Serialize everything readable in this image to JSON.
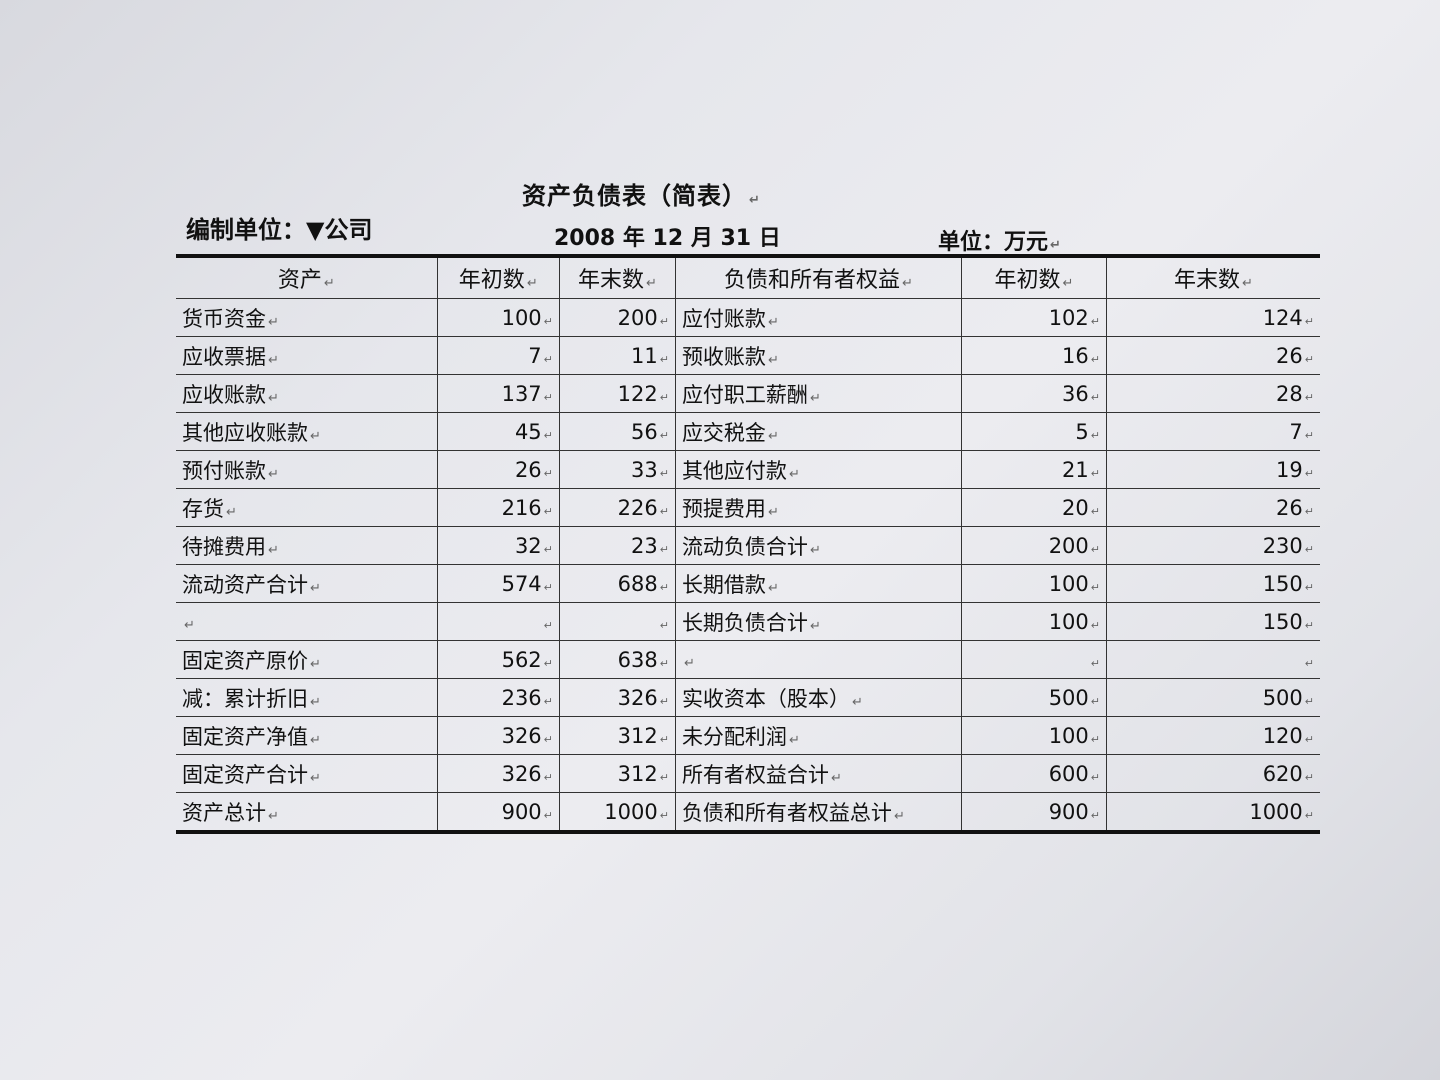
{
  "document": {
    "title": "资产负债表（简表）",
    "org_label": "编制单位：",
    "org_name": "▼公司",
    "date": "2008 年 12 月 31 日",
    "unit": "单位：万元"
  },
  "table": {
    "headers": [
      "资产",
      "年初数",
      "年末数",
      "负债和所有者权益",
      "年初数",
      "年末数"
    ],
    "rows": [
      {
        "asset": "货币资金",
        "a_begin": "100",
        "a_end": "200",
        "liab": "应付账款",
        "l_begin": "102",
        "l_end": "124"
      },
      {
        "asset": "应收票据",
        "a_begin": "7",
        "a_end": "11",
        "liab": "预收账款",
        "l_begin": "16",
        "l_end": "26"
      },
      {
        "asset": "应收账款",
        "a_begin": "137",
        "a_end": "122",
        "liab": "应付职工薪酬",
        "l_begin": "36",
        "l_end": "28"
      },
      {
        "asset": "其他应收账款",
        "a_begin": "45",
        "a_end": "56",
        "liab": "应交税金",
        "l_begin": "5",
        "l_end": "7"
      },
      {
        "asset": "预付账款",
        "a_begin": "26",
        "a_end": "33",
        "liab": "其他应付款",
        "l_begin": "21",
        "l_end": "19"
      },
      {
        "asset": "存货",
        "a_begin": "216",
        "a_end": "226",
        "liab": "预提费用",
        "l_begin": "20",
        "l_end": "26"
      },
      {
        "asset": "待摊费用",
        "a_begin": "32",
        "a_end": "23",
        "liab": "流动负债合计",
        "l_begin": "200",
        "l_end": "230"
      },
      {
        "asset": "流动资产合计",
        "a_begin": "574",
        "a_end": "688",
        "liab": "长期借款",
        "l_begin": "100",
        "l_end": "150"
      },
      {
        "asset": "",
        "a_begin": "",
        "a_end": "",
        "liab": "长期负债合计",
        "l_begin": "100",
        "l_end": "150"
      },
      {
        "asset": "固定资产原价",
        "a_begin": "562",
        "a_end": "638",
        "liab": "",
        "l_begin": "",
        "l_end": ""
      },
      {
        "asset": "减：累计折旧",
        "a_begin": "236",
        "a_end": "326",
        "liab": "实收资本（股本）",
        "l_begin": "500",
        "l_end": "500"
      },
      {
        "asset": "固定资产净值",
        "a_begin": "326",
        "a_end": "312",
        "liab": "未分配利润",
        "l_begin": "100",
        "l_end": "120"
      },
      {
        "asset": "固定资产合计",
        "a_begin": "326",
        "a_end": "312",
        "liab": "所有者权益合计",
        "l_begin": "600",
        "l_end": "620"
      },
      {
        "asset": "资产总计",
        "a_begin": "900",
        "a_end": "1000",
        "liab": "负债和所有者权益总计",
        "l_begin": "900",
        "l_end": "1000"
      }
    ]
  }
}
